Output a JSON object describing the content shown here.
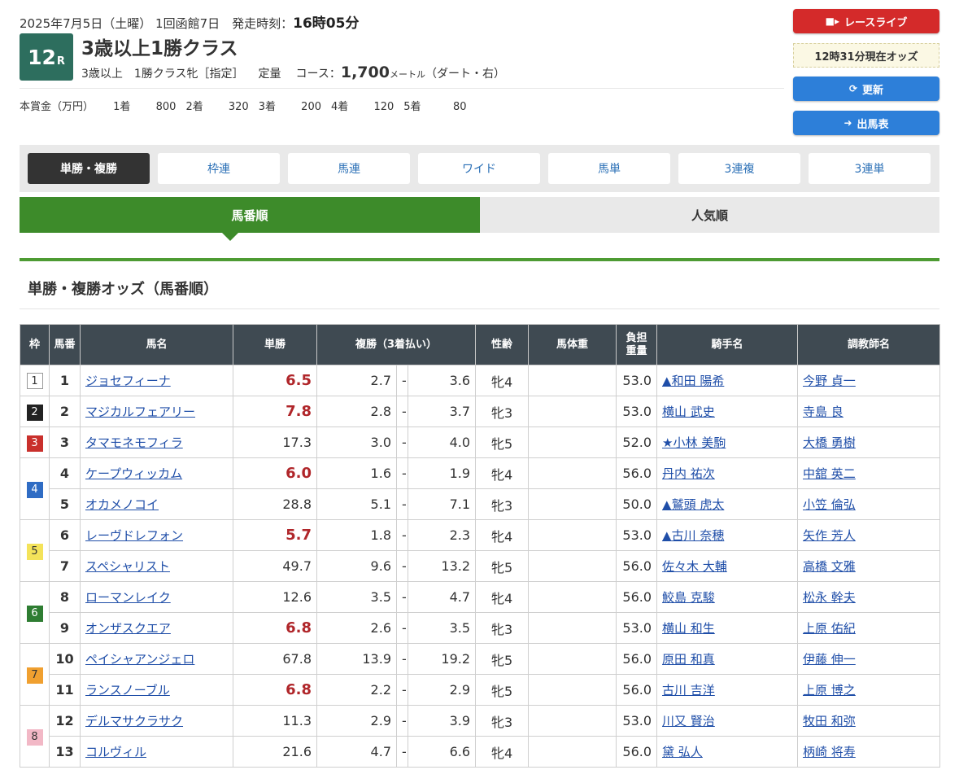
{
  "header": {
    "date_text": "2025年7月5日（土曜） 1回函館7日　発走時刻：",
    "post_time": "16時05分",
    "race_number": "12",
    "race_suffix": "R",
    "race_name": "3歳以上1勝クラス",
    "conditions": "3歳以上　1勝クラス牝［指定］",
    "weight_rule": "定量",
    "course_label": "コース：",
    "distance": "1,700",
    "distance_unit": "メートル",
    "course_detail": "（ダート・右）",
    "prize_label": "本賞金（万円）",
    "prizes": [
      {
        "place": "1着",
        "amount": "800"
      },
      {
        "place": "2着",
        "amount": "320"
      },
      {
        "place": "3着",
        "amount": "200"
      },
      {
        "place": "4着",
        "amount": "120"
      },
      {
        "place": "5着",
        "amount": "80"
      }
    ]
  },
  "side_buttons": {
    "live": "レースライブ",
    "odds_time": "12時31分現在オッズ",
    "refresh": "更新",
    "shutuba": "出馬表"
  },
  "bet_tabs": [
    "単勝・複勝",
    "枠連",
    "馬連",
    "ワイド",
    "馬単",
    "3連複",
    "3連単"
  ],
  "sort_tabs": [
    "馬番順",
    "人気順"
  ],
  "section_title": "単勝・複勝オッズ（馬番順）",
  "table": {
    "headers": {
      "waku": "枠",
      "umaban": "馬番",
      "horse": "馬名",
      "win": "単勝",
      "place": "複勝（3着払い）",
      "sexage": "性齢",
      "body_weight": "馬体重",
      "burden1": "負担",
      "burden2": "重量",
      "jockey": "騎手名",
      "trainer": "調教師名"
    },
    "waku_colors": {
      "1": "#ffffff",
      "2": "#222222",
      "3": "#c9302c",
      "4": "#2f6cc4",
      "5": "#f4e35a",
      "6": "#2e7d32",
      "7": "#f0a030",
      "8": "#f2b8c6"
    },
    "rows": [
      {
        "waku": "1",
        "umaban": "1",
        "horse": "ジョセフィーナ",
        "win": "6.5",
        "pop": true,
        "pmin": "2.7",
        "pmax": "3.6",
        "sexage": "牝4",
        "weight": "53.0",
        "jockey": "▲和田 陽希",
        "trainer": "今野 貞一"
      },
      {
        "waku": "2",
        "umaban": "2",
        "horse": "マジカルフェアリー",
        "win": "7.8",
        "pop": true,
        "pmin": "2.8",
        "pmax": "3.7",
        "sexage": "牝3",
        "weight": "53.0",
        "jockey": "横山 武史",
        "trainer": "寺島 良"
      },
      {
        "waku": "3",
        "umaban": "3",
        "horse": "タマモネモフィラ",
        "win": "17.3",
        "pop": false,
        "pmin": "3.0",
        "pmax": "4.0",
        "sexage": "牝5",
        "weight": "52.0",
        "jockey": "★小林 美駒",
        "trainer": "大橋 勇樹"
      },
      {
        "waku": "4",
        "umaban": "4",
        "horse": "ケープウィッカム",
        "win": "6.0",
        "pop": true,
        "pmin": "1.6",
        "pmax": "1.9",
        "sexage": "牝4",
        "weight": "56.0",
        "jockey": "丹内 祐次",
        "trainer": "中舘 英二"
      },
      {
        "waku": "4",
        "umaban": "5",
        "horse": "オカメノコイ",
        "win": "28.8",
        "pop": false,
        "pmin": "5.1",
        "pmax": "7.1",
        "sexage": "牝3",
        "weight": "50.0",
        "jockey": "▲鷲頭 虎太",
        "trainer": "小笠 倫弘"
      },
      {
        "waku": "5",
        "umaban": "6",
        "horse": "レーヴドレフォン",
        "win": "5.7",
        "pop": true,
        "pmin": "1.8",
        "pmax": "2.3",
        "sexage": "牝4",
        "weight": "53.0",
        "jockey": "▲古川 奈穂",
        "trainer": "矢作 芳人"
      },
      {
        "waku": "5",
        "umaban": "7",
        "horse": "スペシャリスト",
        "win": "49.7",
        "pop": false,
        "pmin": "9.6",
        "pmax": "13.2",
        "sexage": "牝5",
        "weight": "56.0",
        "jockey": "佐々木 大輔",
        "trainer": "高橋 文雅"
      },
      {
        "waku": "6",
        "umaban": "8",
        "horse": "ローマンレイク",
        "win": "12.6",
        "pop": false,
        "pmin": "3.5",
        "pmax": "4.7",
        "sexage": "牝4",
        "weight": "56.0",
        "jockey": "鮫島 克駿",
        "trainer": "松永 幹夫"
      },
      {
        "waku": "6",
        "umaban": "9",
        "horse": "オンザスクエア",
        "win": "6.8",
        "pop": true,
        "pmin": "2.6",
        "pmax": "3.5",
        "sexage": "牝3",
        "weight": "53.0",
        "jockey": "横山 和生",
        "trainer": "上原 佑紀"
      },
      {
        "waku": "7",
        "umaban": "10",
        "horse": "ペイシャアンジェロ",
        "win": "67.8",
        "pop": false,
        "pmin": "13.9",
        "pmax": "19.2",
        "sexage": "牝5",
        "weight": "56.0",
        "jockey": "原田 和真",
        "trainer": "伊藤 伸一"
      },
      {
        "waku": "7",
        "umaban": "11",
        "horse": "ランスノーブル",
        "win": "6.8",
        "pop": true,
        "pmin": "2.2",
        "pmax": "2.9",
        "sexage": "牝5",
        "weight": "56.0",
        "jockey": "古川 吉洋",
        "trainer": "上原 博之"
      },
      {
        "waku": "8",
        "umaban": "12",
        "horse": "デルマサクラサク",
        "win": "11.3",
        "pop": false,
        "pmin": "2.9",
        "pmax": "3.9",
        "sexage": "牝3",
        "weight": "53.0",
        "jockey": "川又 賢治",
        "trainer": "牧田 和弥"
      },
      {
        "waku": "8",
        "umaban": "13",
        "horse": "コルヴィル",
        "win": "21.6",
        "pop": false,
        "pmin": "4.7",
        "pmax": "6.6",
        "sexage": "牝4",
        "weight": "56.0",
        "jockey": "黛 弘人",
        "trainer": "柄崎 将寿"
      }
    ]
  }
}
